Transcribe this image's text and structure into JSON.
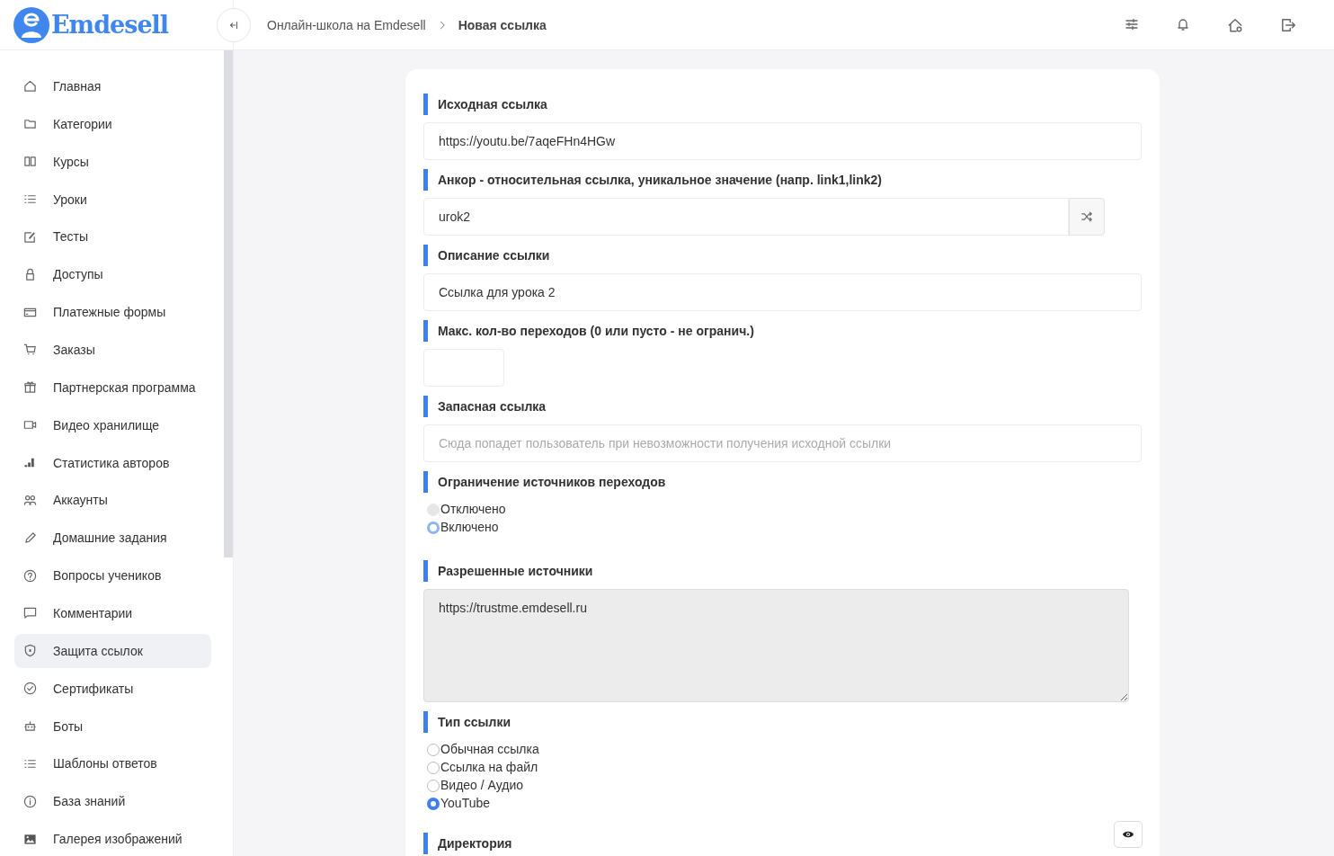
{
  "logo": {
    "text": "Emdesell"
  },
  "breadcrumb": [
    {
      "label": "Онлайн-школа на Emdesell",
      "current": false
    },
    {
      "label": "Новая ссылка",
      "current": true
    }
  ],
  "sidebar": {
    "items": [
      {
        "label": "Главная",
        "selected": false
      },
      {
        "label": "Категории",
        "selected": false
      },
      {
        "label": "Курсы",
        "selected": false
      },
      {
        "label": "Уроки",
        "selected": false
      },
      {
        "label": "Тесты",
        "selected": false
      },
      {
        "label": "Доступы",
        "selected": false
      },
      {
        "label": "Платежные формы",
        "selected": false
      },
      {
        "label": "Заказы",
        "selected": false
      },
      {
        "label": "Партнерская программа",
        "selected": false
      },
      {
        "label": "Видео хранилище",
        "selected": false
      },
      {
        "label": "Статистика авторов",
        "selected": false
      },
      {
        "label": "Аккаунты",
        "selected": false
      },
      {
        "label": "Домашние задания",
        "selected": false
      },
      {
        "label": "Вопросы учеников",
        "selected": false
      },
      {
        "label": "Комментарии",
        "selected": false
      },
      {
        "label": "Защита ссылок",
        "selected": true
      },
      {
        "label": "Сертификаты",
        "selected": false
      },
      {
        "label": "Боты",
        "selected": false
      },
      {
        "label": "Шаблоны ответов",
        "selected": false
      },
      {
        "label": "База знаний",
        "selected": false
      },
      {
        "label": "Галерея изображений",
        "selected": false
      }
    ]
  },
  "form": {
    "fields": [
      {
        "kind": "text",
        "label": "Исходная ссылка",
        "value": "https://youtu.be/7aqeFHn4HGw"
      },
      {
        "kind": "shuffle",
        "label": "Анкор - относительная ссылка, уникальное значение (напр. link1,link2)",
        "value": "urok2"
      },
      {
        "kind": "text",
        "label": "Описание ссылки",
        "value": "Ссылка для урока 2"
      },
      {
        "kind": "number",
        "label": "Макс. кол-во переходов (0 или пусто - не огранич.)"
      },
      {
        "kind": "text",
        "label": "Запасная ссылка",
        "placeholder": "Сюда попадет пользователь при невозможности получения исходной ссылки"
      },
      {
        "kind": "radio",
        "label": "Ограничение источников переходов",
        "disabled": true,
        "options": [
          {
            "label": "Отключено",
            "selected": false
          },
          {
            "label": "Включено",
            "selected": true
          }
        ]
      },
      {
        "kind": "textarea",
        "label": "Разрешенные источники",
        "disabled": true,
        "value": "https://trustme.emdesell.ru"
      },
      {
        "kind": "radio",
        "label": "Тип ссылки",
        "disabled": false,
        "options": [
          {
            "label": "Обычная ссылка",
            "selected": false
          },
          {
            "label": "Ссылка на файл",
            "selected": false
          },
          {
            "label": "Видео / Аудио",
            "selected": false
          },
          {
            "label": "YouTube",
            "selected": true
          }
        ]
      },
      {
        "kind": "heading-eye",
        "label": "Директория"
      }
    ]
  }
}
